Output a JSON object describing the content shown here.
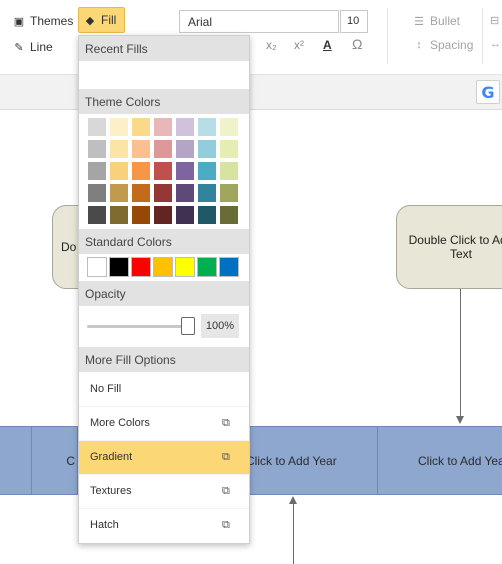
{
  "toolbar": {
    "themes_label": "Themes",
    "line_label": "Line",
    "fill_label": "Fill",
    "font_name": "Arial",
    "font_size": "10",
    "bullet_label": "Bullet",
    "spacing_label": "Spacing",
    "subscript": "x₂",
    "superscript": "x²",
    "font_color_glyph": "A",
    "omega_glyph": "Ω"
  },
  "canvas": {
    "node_left_text": "Do",
    "node_right_text": "Double Click to Add Text",
    "timeline": {
      "cell_1": "C",
      "cell_2": "Click to Add Year",
      "cell_3": "Click to Add Year"
    }
  },
  "fill_menu": {
    "recent_fills_title": "Recent Fills",
    "theme_colors_title": "Theme Colors",
    "theme_colors": [
      [
        "#d8d8d8",
        "#fdf0c8",
        "#fbd98a",
        "#e8b8b8",
        "#d1c1dd",
        "#b7dde6",
        "#eff2cb"
      ],
      [
        "#bfbfbf",
        "#fbe4a5",
        "#fac08f",
        "#dd9999",
        "#b4a5c7",
        "#92cddc",
        "#e5ecb4"
      ],
      [
        "#a5a5a5",
        "#f9d07c",
        "#f79646",
        "#c0504d",
        "#8064a2",
        "#4bacc6",
        "#d7e4a0"
      ],
      [
        "#7f7f7f",
        "#c09a4e",
        "#c46b1b",
        "#953735",
        "#5f497a",
        "#31849b",
        "#a0a65d"
      ],
      [
        "#4a4a4a",
        "#7f6a30",
        "#974806",
        "#632423",
        "#3f3151",
        "#205867",
        "#686d38"
      ]
    ],
    "standard_colors_title": "Standard Colors",
    "standard_colors": [
      "#ffffff",
      "#000000",
      "#ff0000",
      "#ffc000",
      "#ffff00",
      "#00b050",
      "#0070c0"
    ],
    "opacity_title": "Opacity",
    "opacity_value": "100%",
    "more_fill_options_title": "More Fill Options",
    "options": [
      {
        "label": "No Fill",
        "external": false,
        "selected": false
      },
      {
        "label": "More Colors",
        "external": true,
        "selected": false
      },
      {
        "label": "Gradient",
        "external": true,
        "selected": true
      },
      {
        "label": "Textures",
        "external": true,
        "selected": false
      },
      {
        "label": "Hatch",
        "external": true,
        "selected": false
      }
    ],
    "external_icon": "external-link-icon"
  },
  "colors": {
    "accent_yellow": "#fbd775",
    "timeline_blue": "#8ea7cf",
    "node_beige": "#e8e6d6"
  },
  "search": {
    "engine_glyph": "G"
  }
}
